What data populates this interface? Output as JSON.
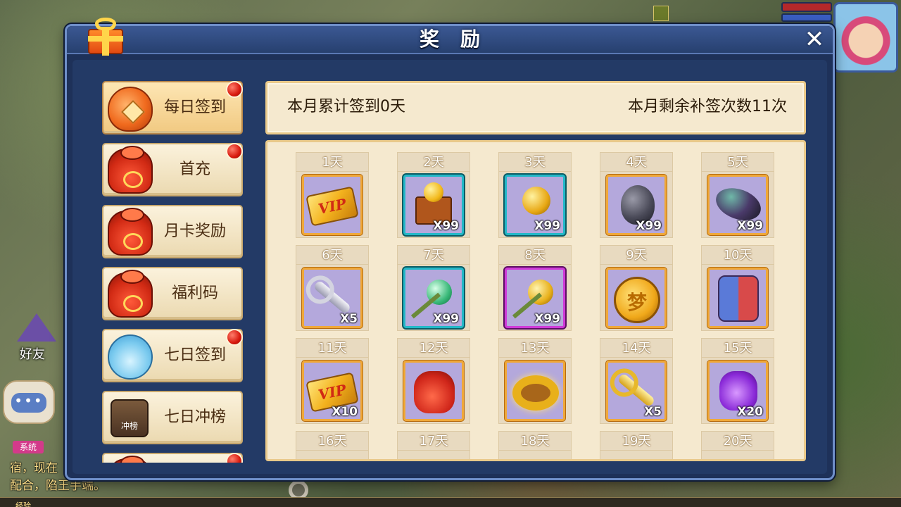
{
  "background": {
    "friend_label": "好友",
    "chat_dots": "•••",
    "system_tag": "系统",
    "chat_line_1": "宿，现在",
    "chat_line_2": "配合，陷王手端。",
    "exp_label": "经验"
  },
  "panel": {
    "title": "奖励",
    "close_glyph": "✕",
    "gift_icon": "gift-box-icon"
  },
  "sidebar": {
    "items": [
      {
        "label": "每日签到",
        "icon": "lantern-coin-icon",
        "badge": true,
        "active": true
      },
      {
        "label": "首充",
        "icon": "red-lucky-bag-icon",
        "badge": true,
        "active": false
      },
      {
        "label": "月卡奖励",
        "icon": "red-lucky-bag-icon",
        "badge": false,
        "active": false
      },
      {
        "label": "福利码",
        "icon": "red-lucky-bag-icon",
        "badge": false,
        "active": false
      },
      {
        "label": "七日签到",
        "icon": "blue-cloud-bag-icon",
        "badge": true,
        "active": false
      },
      {
        "label": "七日冲榜",
        "icon": "ranking-board-icon",
        "icon_text": "冲榜",
        "badge": false,
        "active": false
      },
      {
        "label": "",
        "icon": "partial-item-icon",
        "badge": true,
        "active": false
      }
    ]
  },
  "info": {
    "signed_text": "本月累计签到0天",
    "remaining_text": "本月剩余补签次数11次"
  },
  "days": [
    {
      "label": "1天",
      "item": "vip-card-icon",
      "qty": "",
      "frame": "gold"
    },
    {
      "label": "2天",
      "item": "treasure-chest-icon",
      "qty": "X99",
      "frame": "teal"
    },
    {
      "label": "3天",
      "item": "golden-orb-icon",
      "qty": "X99",
      "frame": "teal"
    },
    {
      "label": "4天",
      "item": "dark-gourd-icon",
      "qty": "X99",
      "frame": "gold"
    },
    {
      "label": "5天",
      "item": "colored-stone-icon",
      "qty": "X99",
      "frame": "gold"
    },
    {
      "label": "6天",
      "item": "silver-key-icon",
      "qty": "X5",
      "frame": "gold"
    },
    {
      "label": "7天",
      "item": "green-hammer-icon",
      "qty": "X99",
      "frame": "teal"
    },
    {
      "label": "8天",
      "item": "gold-hammer-icon",
      "qty": "X99",
      "frame": "purple"
    },
    {
      "label": "9天",
      "item": "dream-coin-icon",
      "qty": "",
      "frame": "gold"
    },
    {
      "label": "10天",
      "item": "mech-robot-icon",
      "qty": "",
      "frame": "gold"
    },
    {
      "label": "11天",
      "item": "vip-card-icon",
      "qty": "X10",
      "frame": "gold"
    },
    {
      "label": "12天",
      "item": "red-lucky-bag-icon",
      "qty": "",
      "frame": "gold"
    },
    {
      "label": "13天",
      "item": "golden-ring-icon",
      "qty": "",
      "frame": "gold"
    },
    {
      "label": "14天",
      "item": "golden-key-icon",
      "qty": "X5",
      "frame": "gold"
    },
    {
      "label": "15天",
      "item": "purple-bag-icon",
      "qty": "X20",
      "frame": "gold"
    },
    {
      "label": "16天",
      "item": "",
      "qty": "",
      "frame": "gold"
    },
    {
      "label": "17天",
      "item": "",
      "qty": "",
      "frame": "gold"
    },
    {
      "label": "18天",
      "item": "",
      "qty": "",
      "frame": "gold"
    },
    {
      "label": "19天",
      "item": "",
      "qty": "",
      "frame": "gold"
    },
    {
      "label": "20天",
      "item": "",
      "qty": "",
      "frame": "gold"
    }
  ]
}
